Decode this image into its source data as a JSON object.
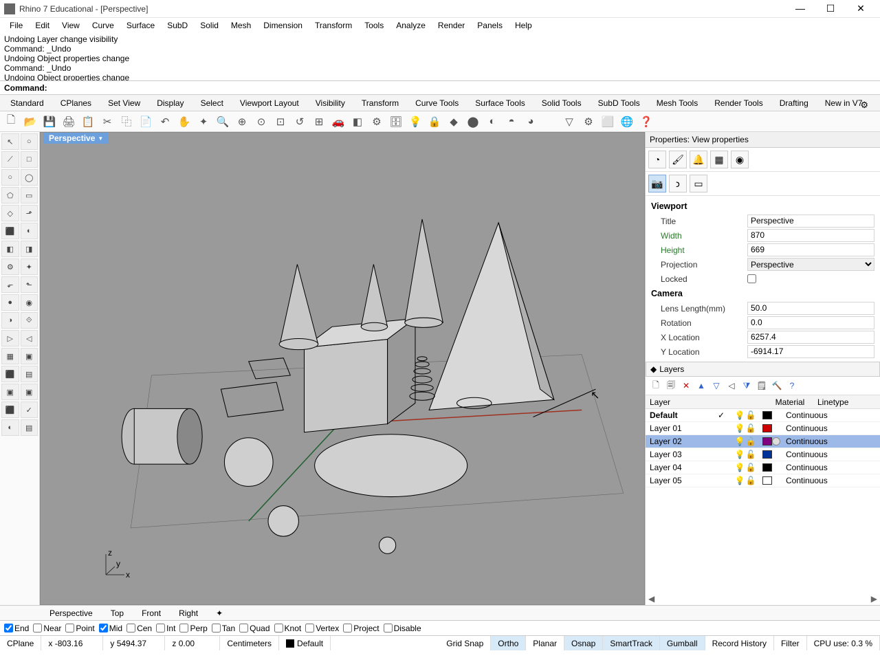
{
  "window": {
    "title": "Rhino 7 Educational - [Perspective]"
  },
  "menus": [
    "File",
    "Edit",
    "View",
    "Curve",
    "Surface",
    "SubD",
    "Solid",
    "Mesh",
    "Dimension",
    "Transform",
    "Tools",
    "Analyze",
    "Render",
    "Panels",
    "Help"
  ],
  "cmdlog": [
    "Undoing Layer   change visibility",
    "Command: _Undo",
    "Undoing Object properties change",
    "Command: _Undo",
    "Undoing Object properties change"
  ],
  "cmdprompt": "Command:",
  "tabs": [
    "Standard",
    "CPlanes",
    "Set View",
    "Display",
    "Select",
    "Viewport Layout",
    "Visibility",
    "Transform",
    "Curve Tools",
    "Surface Tools",
    "Solid Tools",
    "SubD Tools",
    "Mesh Tools",
    "Render Tools",
    "Drafting",
    "New in V7"
  ],
  "viewport_label": "Perspective",
  "properties_title": "Properties: View properties",
  "viewport_section": "Viewport",
  "camera_section": "Camera",
  "props": {
    "title_lbl": "Title",
    "title_val": "Perspective",
    "width_lbl": "Width",
    "width_val": "870",
    "height_lbl": "Height",
    "height_val": "669",
    "proj_lbl": "Projection",
    "proj_val": "Perspective",
    "locked_lbl": "Locked",
    "lens_lbl": "Lens Length(mm)",
    "lens_val": "50.0",
    "rot_lbl": "Rotation",
    "rot_val": "0.0",
    "x_lbl": "X Location",
    "x_val": "6257.4",
    "y_lbl": "Y Location",
    "y_val": "-6914.17"
  },
  "layers_title": "Layers",
  "layer_headers": {
    "layer": "Layer",
    "material": "Material",
    "linetype": "Linetype"
  },
  "layers": [
    {
      "name": "Default",
      "bold": true,
      "current": true,
      "color": "#000",
      "linetype": "Continuous"
    },
    {
      "name": "Layer 01",
      "color": "#c00",
      "linetype": "Continuous"
    },
    {
      "name": "Layer 02",
      "sel": true,
      "color": "#800080",
      "mat": true,
      "linetype": "Continuous"
    },
    {
      "name": "Layer 03",
      "color": "#003399",
      "linetype": "Continuous"
    },
    {
      "name": "Layer 04",
      "color": "#000",
      "linetype": "Continuous"
    },
    {
      "name": "Layer 05",
      "color": "#fff",
      "linetype": "Continuous"
    }
  ],
  "viewtabs": [
    "Perspective",
    "Top",
    "Front",
    "Right"
  ],
  "snaps": [
    {
      "label": "End",
      "on": true
    },
    {
      "label": "Near",
      "on": false
    },
    {
      "label": "Point",
      "on": false
    },
    {
      "label": "Mid",
      "on": true
    },
    {
      "label": "Cen",
      "on": false
    },
    {
      "label": "Int",
      "on": false
    },
    {
      "label": "Perp",
      "on": false
    },
    {
      "label": "Tan",
      "on": false
    },
    {
      "label": "Quad",
      "on": false
    },
    {
      "label": "Knot",
      "on": false
    },
    {
      "label": "Vertex",
      "on": false
    },
    {
      "label": "Project",
      "on": false
    },
    {
      "label": "Disable",
      "on": false
    }
  ],
  "status": {
    "cplane": "CPlane",
    "x": "x -803.16",
    "y": "y 5494.37",
    "z": "z 0.00",
    "units": "Centimeters",
    "layer": "Default",
    "gridsnap": "Grid Snap",
    "ortho": "Ortho",
    "planar": "Planar",
    "osnap": "Osnap",
    "smarttrack": "SmartTrack",
    "gumball": "Gumball",
    "record": "Record History",
    "filter": "Filter",
    "cpu": "CPU use: 0.3 %"
  }
}
